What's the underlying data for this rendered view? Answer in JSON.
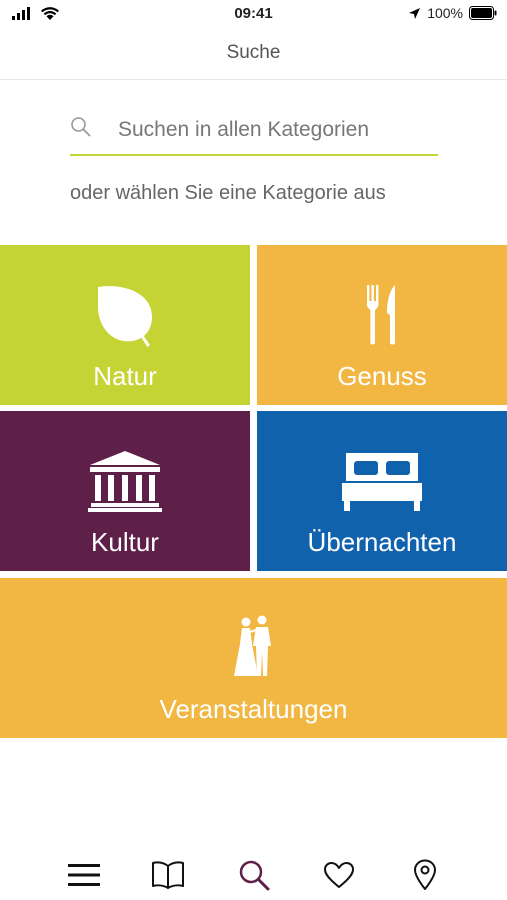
{
  "status_bar": {
    "time": "09:41",
    "battery": "100%"
  },
  "nav": {
    "title": "Suche"
  },
  "search": {
    "placeholder": "Suchen in allen Kategorien",
    "value": ""
  },
  "hint": "oder wählen Sie eine Kategorie aus",
  "categories": [
    {
      "label": "Natur",
      "icon": "leaf-icon",
      "color": "#c5d434"
    },
    {
      "label": "Genuss",
      "icon": "fork-knife-icon",
      "color": "#f1b742"
    },
    {
      "label": "Kultur",
      "icon": "museum-icon",
      "color": "#5e2049"
    },
    {
      "label": "Übernachten",
      "icon": "bed-icon",
      "color": "#1162ad"
    },
    {
      "label": "Veranstaltungen",
      "icon": "wedding-couple-icon",
      "color": "#f1b742"
    }
  ],
  "tabbar": {
    "items": [
      {
        "icon": "menu-icon"
      },
      {
        "icon": "book-icon"
      },
      {
        "icon": "search-icon",
        "active": true
      },
      {
        "icon": "heart-icon"
      },
      {
        "icon": "location-pin-icon"
      }
    ],
    "active_color": "#5e2049"
  },
  "accent_color": "#c5d434"
}
